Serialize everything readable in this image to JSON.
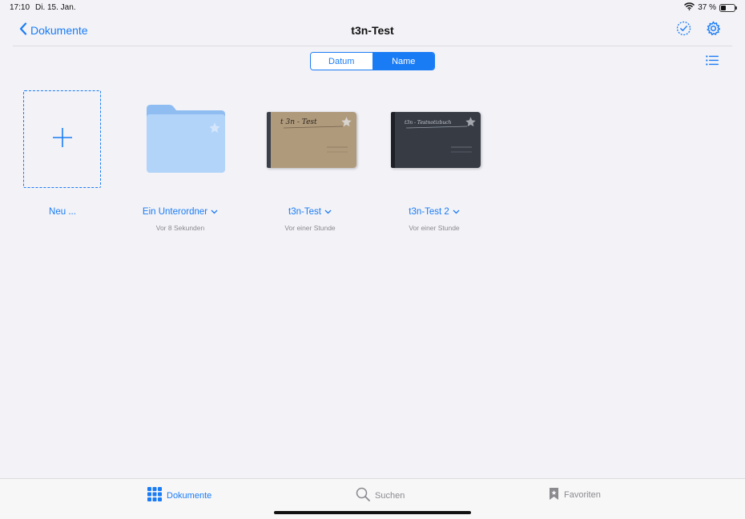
{
  "status": {
    "time": "17:10",
    "date": "Di. 15. Jan.",
    "battery_text": "37 %",
    "battery_level": 0.37
  },
  "nav": {
    "back_label": "Dokumente",
    "title": "t3n-Test"
  },
  "sort": {
    "options": [
      "Datum",
      "Name"
    ],
    "selected": "Name"
  },
  "items": [
    {
      "label": "Neu ...",
      "subtitle": ""
    },
    {
      "label": "Ein Unterordner",
      "subtitle": "Vor 8 Sekunden"
    },
    {
      "label": "t3n-Test",
      "subtitle": "Vor einer Stunde",
      "cover_text": "t 3n - Test",
      "cover_color": "#b09a7c"
    },
    {
      "label": "t3n-Test 2",
      "subtitle": "Vor einer Stunde",
      "cover_text": "t3n - Testnotizbuch",
      "cover_color": "#363b44"
    }
  ],
  "tabs": [
    {
      "label": "Dokumente",
      "icon": "grid-icon",
      "active": true
    },
    {
      "label": "Suchen",
      "icon": "search-icon",
      "active": false
    },
    {
      "label": "Favoriten",
      "icon": "bookmark-icon",
      "active": false
    }
  ],
  "colors": {
    "accent": "#1a7cf5",
    "folder": "#a8cdf7"
  }
}
